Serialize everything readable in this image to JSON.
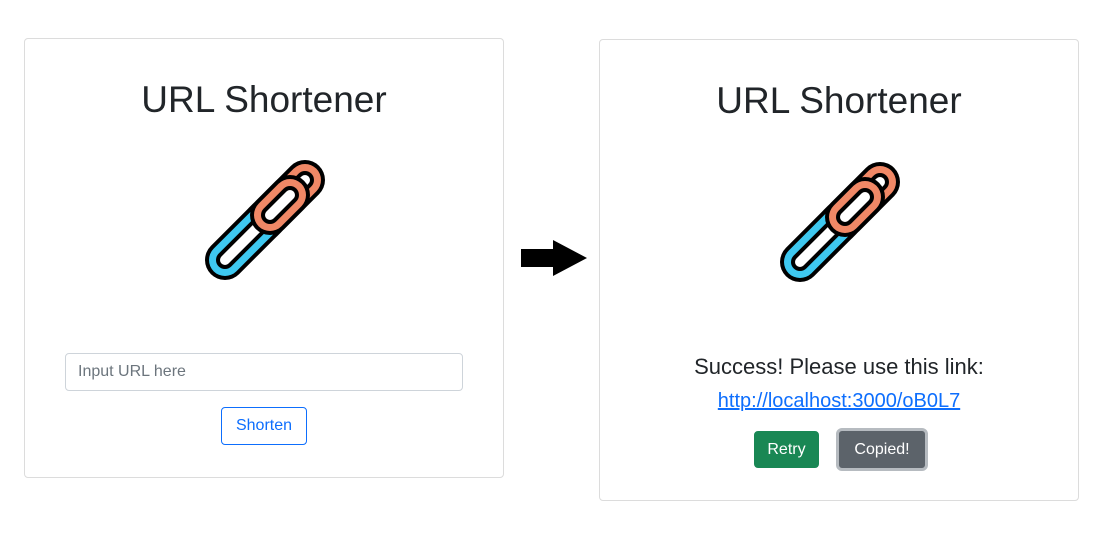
{
  "left_card": {
    "title": "URL Shortener",
    "logo_icon": "chain-link-icon",
    "input": {
      "value": "",
      "placeholder": "Input URL here"
    },
    "shorten_label": "Shorten"
  },
  "transition_icon": "right-arrow-icon",
  "right_card": {
    "title": "URL Shortener",
    "logo_icon": "chain-link-icon",
    "success_message": "Success! Please use this link:",
    "short_link": "http://localhost:3000/oB0L7",
    "retry_label": "Retry",
    "copied_label": "Copied!"
  },
  "colors": {
    "link_blue": "#0d6efd",
    "retry_green": "#198754",
    "copied_gray": "#5c636a",
    "chain_orange": "#f08866",
    "chain_blue": "#3ec8f0"
  }
}
